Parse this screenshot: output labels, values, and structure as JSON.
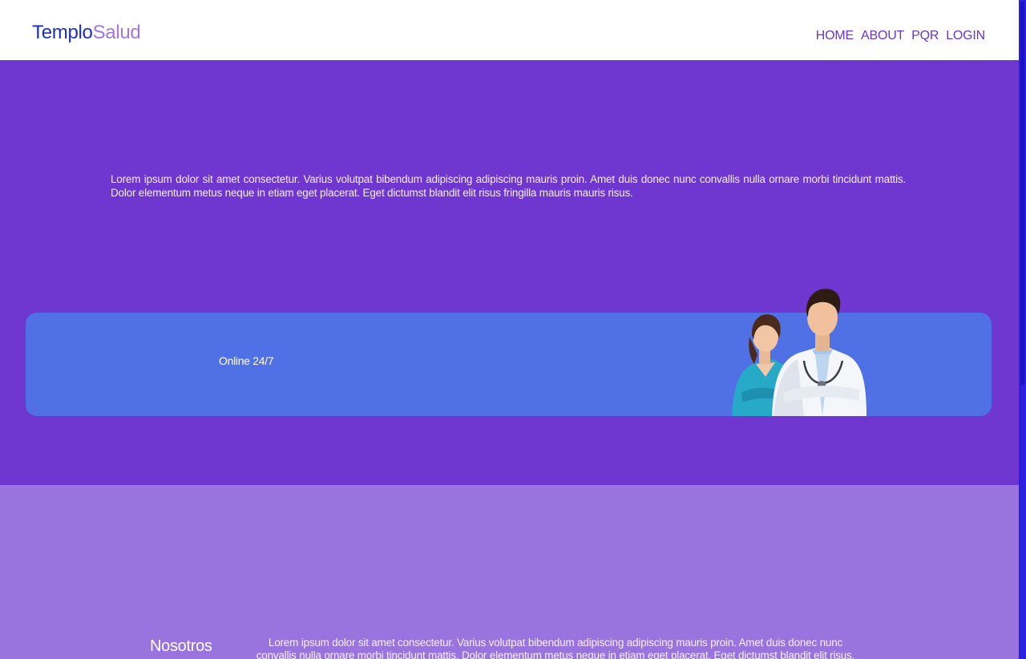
{
  "header": {
    "logo_part_1": "Templo",
    "logo_part_2": "Salud",
    "nav": [
      "HOME",
      "ABOUT",
      "PQR",
      "LOGIN"
    ]
  },
  "hero": {
    "text": "Lorem ipsum dolor sit amet consectetur. Varius volutpat bibendum adipiscing adipiscing mauris proin. Amet duis donec nunc convallis nulla ornare morbi tincidunt mattis. Dolor elementum metus neque in etiam eget placerat. Eget dictumst blandit elit risus fringilla mauris mauris risus.",
    "banner_label": "Online 24/7",
    "image_icon": "doctors-illustration"
  },
  "about": {
    "title": "Nosotros",
    "text": "Lorem ipsum dolor sit amet consectetur. Varius volutpat bibendum adipiscing adipiscing mauris proin. Amet duis donec nunc convallis nulla ornare morbi tincidunt mattis. Dolor elementum metus neque in etiam eget placerat. Eget dictumst blandit elit risus."
  },
  "colors": {
    "brand_dark": "#1b2fc4",
    "brand_light": "#a277de",
    "nav_text": "#6a35c9",
    "hero_bg": "#6f37cf",
    "banner_bg": "#5070e6",
    "about_bg": "#9a74de",
    "scrollbar": "#2b1fe0"
  }
}
